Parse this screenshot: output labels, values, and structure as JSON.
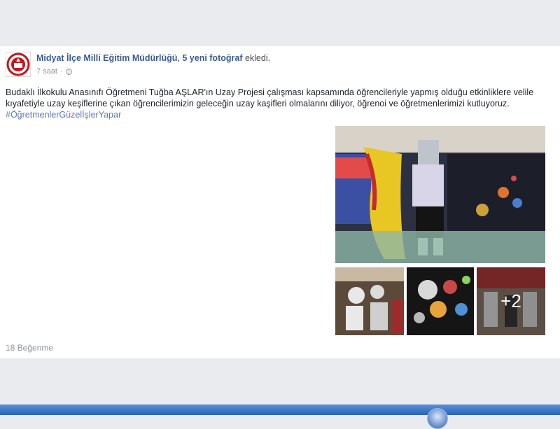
{
  "post": {
    "page_name": "Midyat İlçe Milli Eğitim Müdürlüğü",
    "separator": ", ",
    "photo_count_text": "5 yeni fotoğraf",
    "action": " ekledi.",
    "time": "7 saat",
    "privacy_icon": "globe-icon",
    "text_lines": [
      "Budaklı İlkokulu Anasınıfı Öğretmeni Tuğba AŞLAR'ın Uzay Projesi çalışması kapsamında öğrencileriyle yapmış olduğu etkinliklere velile",
      "kıyafetiyle uzay keşiflerine çıkan öğrencilerimizin geleceğin uzay kaşifleri olmalarını diliyor, öğrenoi ve öğretmenlerimizi kutluyoruz."
    ],
    "hashtag": "#ÖğretmenlerGüzelİşlerYapar",
    "more_photos": "+2",
    "likes": "18 Beğenme"
  },
  "colors": {
    "link": "#3b5998",
    "hashtag": "#5f77b4",
    "muted": "#90949c",
    "background": "#e9ebee"
  }
}
